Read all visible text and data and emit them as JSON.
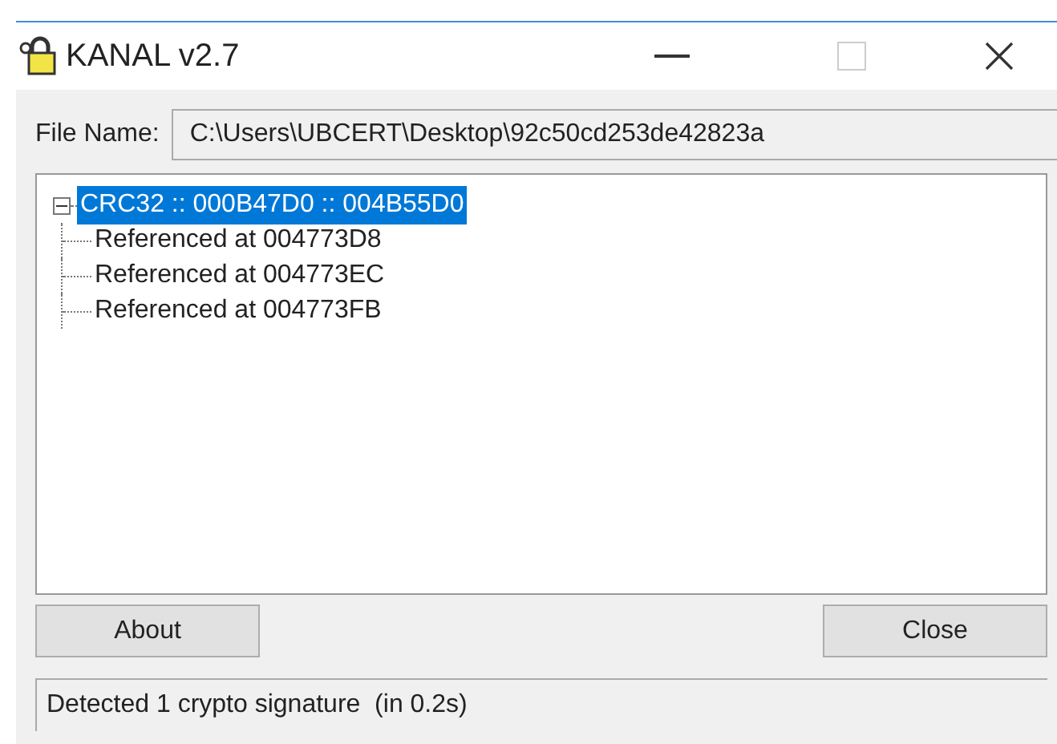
{
  "window": {
    "title": "KANAL v2.7"
  },
  "file_name": {
    "label": "File Name:",
    "value": "C:\\Users\\UBCERT\\Desktop\\92c50cd253de42823a"
  },
  "tree": [
    {
      "label": "CRC32 :: 000B47D0 :: 004B55D0",
      "selected": true,
      "expanded": true,
      "children": [
        {
          "label": "Referenced at 004773D8",
          "selected": false
        },
        {
          "label": "Referenced at 004773EC",
          "selected": false
        },
        {
          "label": "Referenced at 004773FB",
          "selected": false
        }
      ]
    }
  ],
  "buttons": [
    "About",
    "Close"
  ],
  "status_bar": "Detected 1 crypto signature  (in 0.2s)"
}
